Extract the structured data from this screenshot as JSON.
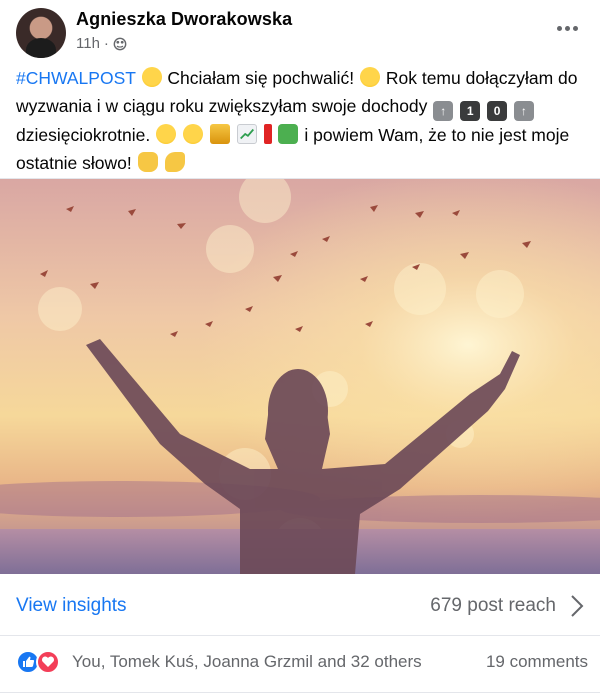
{
  "post": {
    "author": "Agnieszka Dworakowska",
    "time": "11h",
    "separator": "·",
    "text": {
      "hashtag": "#CHWALPOST",
      "part1": " Chciałam się pochwalić! ",
      "part2": " Rok temu dołączyłam do wyzwania i w ciągu roku zwiększyłam swoje dochody ",
      "key1": "1",
      "key0": "0",
      "part3": " dziesięciokrotnie. ",
      "part4": " i powiem Wam, że to nie jest moje ostatnie słowo! "
    },
    "icons": {
      "avatar": "profile-photo",
      "audience": "globe-icon",
      "more": "more-options-icon",
      "chevron": "chevron-right-icon",
      "like": "like-reaction-icon",
      "love": "love-reaction-icon"
    }
  },
  "insights": {
    "link_label": "View insights",
    "reach_label": "679 post reach"
  },
  "engagement": {
    "reactors": "You, Tomek Kuś, Joanna Grzmil and 32 others",
    "comments": "19 comments"
  },
  "colors": {
    "link": "#1877f2",
    "muted": "#65676b",
    "like": "#1877f2",
    "love": "#f33e58"
  }
}
